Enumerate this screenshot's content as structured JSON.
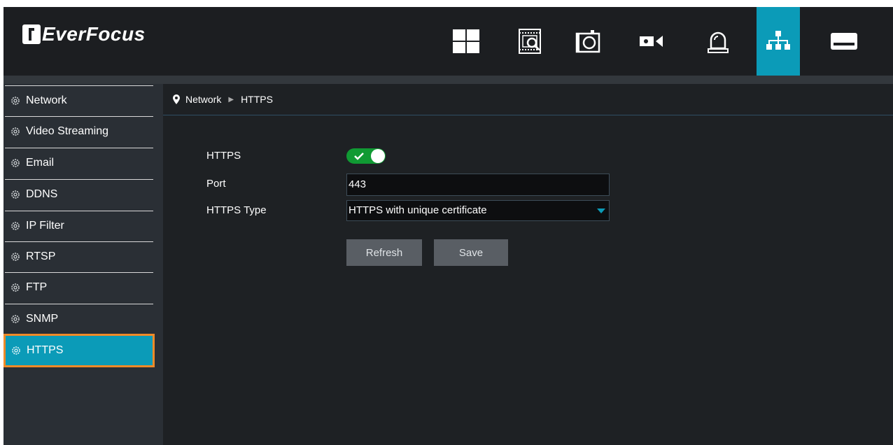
{
  "header": {
    "logo_text": "EverFocus",
    "nav_icons": [
      "layout-icon",
      "playback-search-icon",
      "snapshot-icon",
      "camera-icon",
      "alarm-icon",
      "network-icon",
      "storage-icon"
    ],
    "active_icon": "network-icon",
    "active_color": "#0b9bb8"
  },
  "sidebar": {
    "items": [
      {
        "label": "Network"
      },
      {
        "label": "Video Streaming"
      },
      {
        "label": "Email"
      },
      {
        "label": "DDNS"
      },
      {
        "label": "IP Filter"
      },
      {
        "label": "RTSP"
      },
      {
        "label": "FTP"
      },
      {
        "label": "SNMP"
      },
      {
        "label": "HTTPS"
      }
    ],
    "selected": "HTTPS",
    "highlight_color": "#f08a28"
  },
  "breadcrumb": {
    "parent": "Network",
    "current": "HTTPS"
  },
  "form": {
    "https_label": "HTTPS",
    "https_enabled": true,
    "port_label": "Port",
    "port_value": "443",
    "type_label": "HTTPS Type",
    "type_value": "HTTPS with unique certificate"
  },
  "buttons": {
    "refresh": "Refresh",
    "save": "Save"
  }
}
